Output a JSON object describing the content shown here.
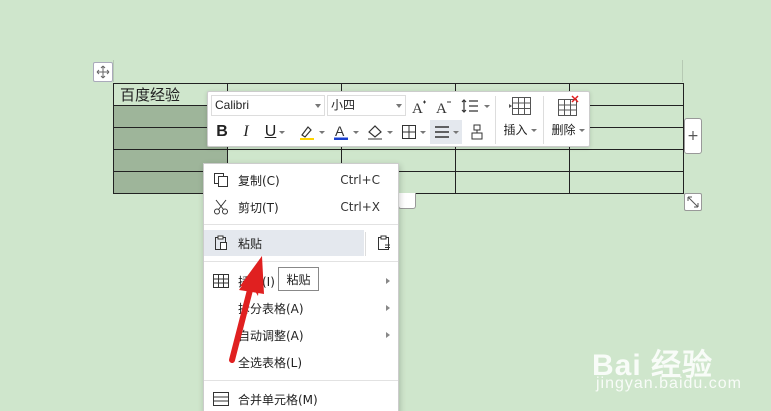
{
  "table": {
    "first_cell_text": "百度经验"
  },
  "toolbar": {
    "font_name": "Calibri",
    "font_size": "小四",
    "insert_label": "插入",
    "delete_label": "删除",
    "font_color": "#1a3fcf"
  },
  "context_menu": {
    "items": [
      {
        "label": "复制(C)",
        "shortcut": "Ctrl+C",
        "icon": "copy-icon"
      },
      {
        "label": "剪切(T)",
        "shortcut": "Ctrl+X",
        "icon": "cut-icon"
      },
      {
        "label": "粘贴",
        "icon": "paste-icon"
      },
      {
        "label": "插入(I)",
        "icon": "table-insert-icon"
      },
      {
        "label": "拆分表格(A)"
      },
      {
        "label": "自动调整(A)"
      },
      {
        "label": "全选表格(L)"
      },
      {
        "label": "合并单元格(M)",
        "icon": "merge-cells-icon"
      }
    ]
  },
  "tooltip": {
    "text": "粘贴"
  },
  "watermark": {
    "logo": "Bai 经验",
    "url": "jingyan.baidu.com"
  },
  "colors": {
    "background": "#cfe6cc",
    "selected_cell": "#9eb59a",
    "annotation_arrow": "#e02020"
  }
}
